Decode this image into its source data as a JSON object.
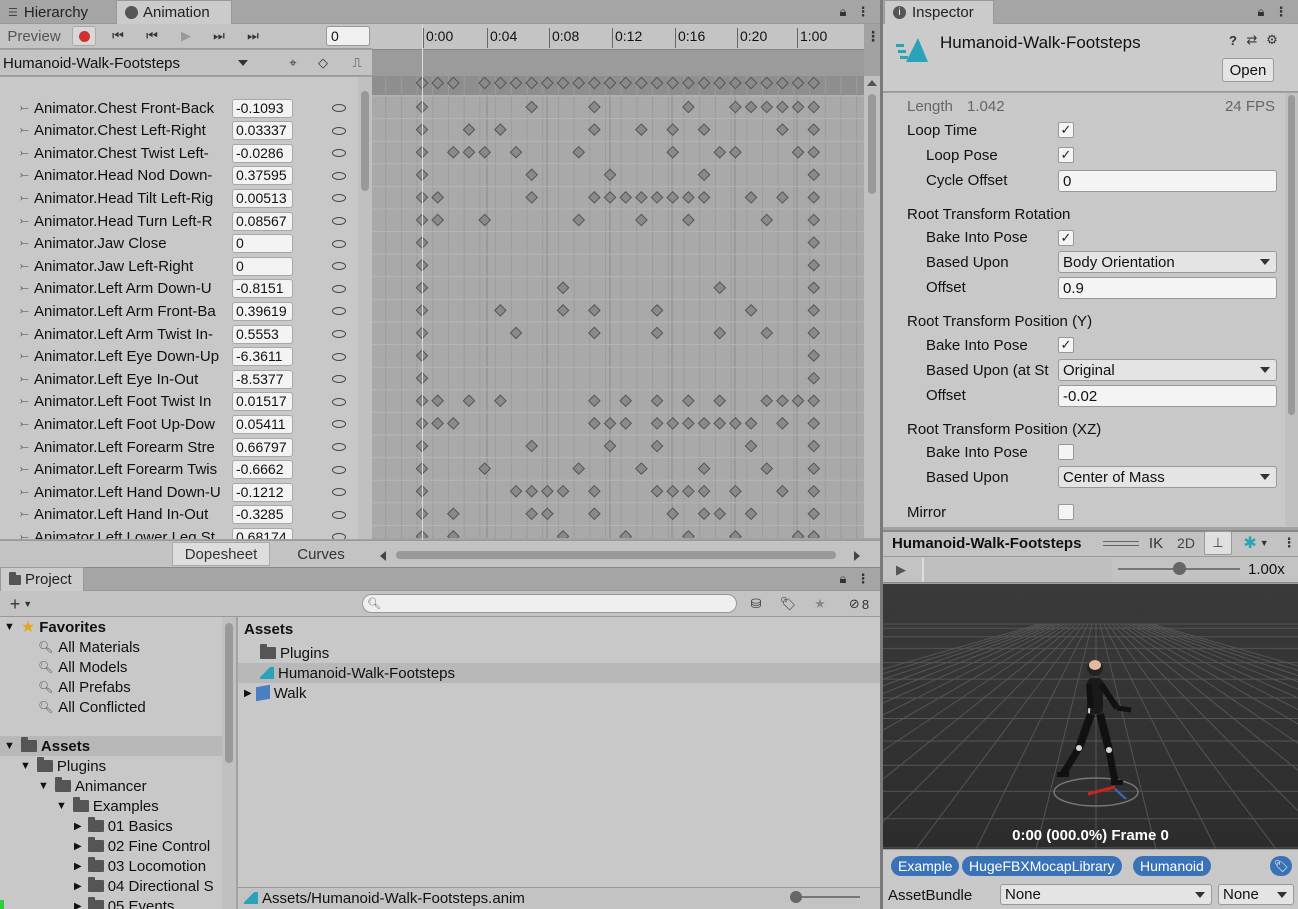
{
  "animation_window": {
    "tabs": {
      "hierarchy": "Hierarchy",
      "animation": "Animation"
    },
    "preview_label": "Preview",
    "frame_value": "0",
    "clip_name": "Humanoid-Walk-Footsteps",
    "ruler_labels": [
      "0:00",
      "0:04",
      "0:08",
      "0:12",
      "0:16",
      "0:20",
      "1:00"
    ],
    "properties": [
      {
        "name": "Animator.Chest Front-Back",
        "value": "-0.1093"
      },
      {
        "name": "Animator.Chest Left-Right",
        "value": "0.03337"
      },
      {
        "name": "Animator.Chest Twist Left-",
        "value": "-0.0286"
      },
      {
        "name": "Animator.Head Nod Down-",
        "value": "0.37595"
      },
      {
        "name": "Animator.Head Tilt Left-Rig",
        "value": "0.00513"
      },
      {
        "name": "Animator.Head Turn Left-R",
        "value": "0.08567"
      },
      {
        "name": "Animator.Jaw Close",
        "value": "0"
      },
      {
        "name": "Animator.Jaw Left-Right",
        "value": "0"
      },
      {
        "name": "Animator.Left Arm Down-U",
        "value": "-0.8151"
      },
      {
        "name": "Animator.Left Arm Front-Ba",
        "value": "0.39619"
      },
      {
        "name": "Animator.Left Arm Twist In-",
        "value": "0.5553"
      },
      {
        "name": "Animator.Left Eye Down-Up",
        "value": "-6.3611"
      },
      {
        "name": "Animator.Left Eye In-Out",
        "value": "-8.5377"
      },
      {
        "name": "Animator.Left Foot Twist In",
        "value": "0.01517"
      },
      {
        "name": "Animator.Left Foot Up-Dow",
        "value": "0.05411"
      },
      {
        "name": "Animator.Left Forearm Stre",
        "value": "0.66797"
      },
      {
        "name": "Animator.Left Forearm Twis",
        "value": "-0.6662"
      },
      {
        "name": "Animator.Left Hand Down-U",
        "value": "-0.1212"
      },
      {
        "name": "Animator.Left Hand In-Out",
        "value": "-0.3285"
      },
      {
        "name": "Animator.Left Lower Leg St",
        "value": "0.68174"
      }
    ],
    "bottom_tabs": {
      "dopesheet": "Dopesheet",
      "curves": "Curves"
    }
  },
  "project_window": {
    "tab": "Project",
    "hidden_count": "8",
    "favorites": {
      "label": "Favorites",
      "items": [
        "All Materials",
        "All Models",
        "All Prefabs",
        "All Conflicted"
      ]
    },
    "tree": {
      "assets": "Assets",
      "plugins": "Plugins",
      "animancer": "Animancer",
      "examples": "Examples",
      "children": [
        "01 Basics",
        "02 Fine Control",
        "03 Locomotion",
        "04 Directional S",
        "05 Events"
      ]
    },
    "assets_header": "Assets",
    "asset_items": [
      "Plugins",
      "Humanoid-Walk-Footsteps",
      "Walk"
    ],
    "path": "Assets/Humanoid-Walk-Footsteps.anim"
  },
  "inspector": {
    "tab": "Inspector",
    "title": "Humanoid-Walk-Footsteps",
    "open_button": "Open",
    "length_label": "Length",
    "length_value": "1.042",
    "fps": "24 FPS",
    "loop_time": "Loop Time",
    "loop_pose": "Loop Pose",
    "cycle_offset": "Cycle Offset",
    "cycle_offset_value": "0",
    "rot_header": "Root Transform Rotation",
    "rot_bake": "Bake Into Pose",
    "rot_based": "Based Upon",
    "rot_based_value": "Body Orientation",
    "rot_offset": "Offset",
    "rot_offset_value": "0.9",
    "posy_header": "Root Transform Position (Y)",
    "posy_bake": "Bake Into Pose",
    "posy_based": "Based Upon (at St",
    "posy_based_value": "Original",
    "posy_offset": "Offset",
    "posy_offset_value": "-0.02",
    "posxz_header": "Root Transform Position (XZ)",
    "posxz_bake": "Bake Into Pose",
    "posxz_based": "Based Upon",
    "posxz_based_value": "Center of Mass",
    "mirror": "Mirror"
  },
  "preview": {
    "title": "Humanoid-Walk-Footsteps",
    "ik": "IK",
    "two_d": "2D",
    "speed": "1.00x",
    "speed_fraction": 0.5,
    "status": "0:00 (000.0%) Frame 0",
    "labels": [
      "Example",
      "HugeFBXMocapLibrary",
      "Humanoid"
    ],
    "assetbundle_label": "AssetBundle",
    "assetbundle_value": "None",
    "variant_value": "None"
  },
  "colors": {
    "label_chip": "#3a72b8",
    "record": "#d03030",
    "key": "#8a8a8a",
    "selected_row": "#b8b8b8",
    "viewport_bg": "#3a3a3a"
  }
}
